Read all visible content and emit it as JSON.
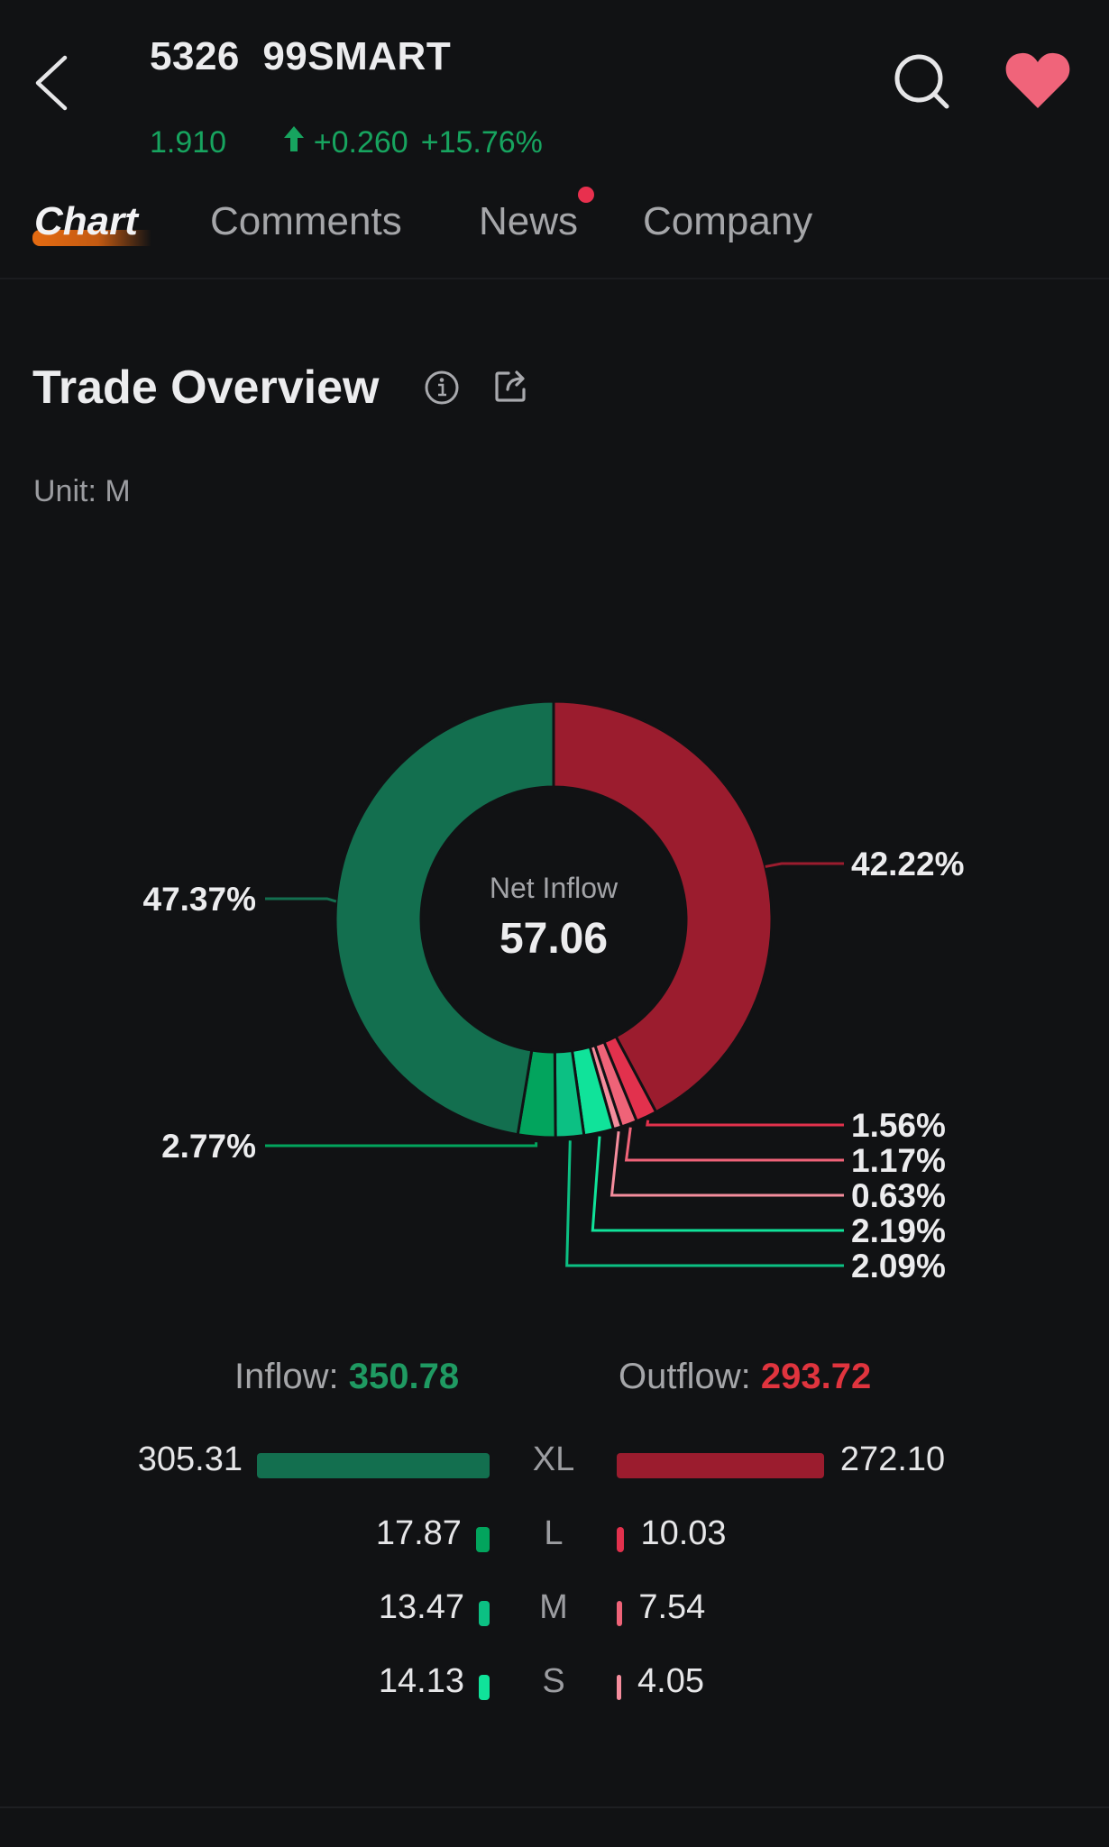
{
  "header": {
    "title": "5326  99SMART",
    "price": "1.910",
    "change": "+0.260",
    "change_pct": "+15.76%",
    "trend": "up",
    "icons": {
      "back": "chevron-left-icon",
      "search": "search-icon",
      "favorite": "heart-icon"
    },
    "favorite_color": "#f0647a",
    "up_color": "#17a45f"
  },
  "tabs": [
    {
      "label": "Chart",
      "active": true,
      "badge": false
    },
    {
      "label": "Comments",
      "active": false,
      "badge": false
    },
    {
      "label": "News",
      "active": false,
      "badge": true
    },
    {
      "label": "Company",
      "active": false,
      "badge": false
    }
  ],
  "section": {
    "title": "Trade Overview",
    "unit": "Unit: M",
    "icons": {
      "info": "info-icon",
      "share": "share-icon"
    }
  },
  "chart_data": {
    "type": "pie",
    "variant": "donut",
    "title": "Trade Overview",
    "unit": "M",
    "center_label": "Net Inflow",
    "center_value": "57.06",
    "start_angle": "12 o'clock",
    "direction": "clockwise",
    "slices": [
      {
        "name": "Outflow XL",
        "value": 272.1,
        "percent": 42.22,
        "label": "42.22%",
        "color": "#9b1c2e",
        "label_side": "right"
      },
      {
        "name": "Outflow L",
        "value": 10.03,
        "percent": 1.56,
        "label": "1.56%",
        "color": "#e2314d",
        "label_side": "right"
      },
      {
        "name": "Outflow M",
        "value": 7.54,
        "percent": 1.17,
        "label": "1.17%",
        "color": "#ef6378",
        "label_side": "right"
      },
      {
        "name": "Outflow S",
        "value": 4.05,
        "percent": 0.63,
        "label": "0.63%",
        "color": "#f58d9d",
        "label_side": "right"
      },
      {
        "name": "Inflow S",
        "value": 14.13,
        "percent": 2.19,
        "label": "2.19%",
        "color": "#10e39a",
        "label_side": "right"
      },
      {
        "name": "Inflow M",
        "value": 13.47,
        "percent": 2.09,
        "label": "2.09%",
        "color": "#0cc083",
        "label_side": "right"
      },
      {
        "name": "Inflow L",
        "value": 17.87,
        "percent": 2.77,
        "label": "2.77%",
        "color": "#02a45d",
        "label_side": "left"
      },
      {
        "name": "Inflow XL",
        "value": 305.31,
        "percent": 47.37,
        "label": "47.37%",
        "color": "#136f4f",
        "label_side": "left"
      }
    ],
    "legend": "none",
    "grid": false
  },
  "summary": {
    "inflow_label": "Inflow: ",
    "inflow_value": "350.78",
    "outflow_label": "Outflow: ",
    "outflow_value": "293.72",
    "rows": [
      {
        "size": "XL",
        "inflow": "305.31",
        "outflow": "272.10",
        "inflow_num": 305.31,
        "outflow_num": 272.1,
        "in_color": "#136f4f",
        "out_color": "#9b1c2e"
      },
      {
        "size": "L",
        "inflow": "17.87",
        "outflow": "10.03",
        "inflow_num": 17.87,
        "outflow_num": 10.03,
        "in_color": "#02a45d",
        "out_color": "#e2314d"
      },
      {
        "size": "M",
        "inflow": "13.47",
        "outflow": "7.54",
        "inflow_num": 13.47,
        "outflow_num": 7.54,
        "in_color": "#0cc083",
        "out_color": "#ef6378"
      },
      {
        "size": "S",
        "inflow": "14.13",
        "outflow": "4.05",
        "inflow_num": 14.13,
        "outflow_num": 4.05,
        "in_color": "#10e39a",
        "out_color": "#f58d9d"
      }
    ]
  }
}
